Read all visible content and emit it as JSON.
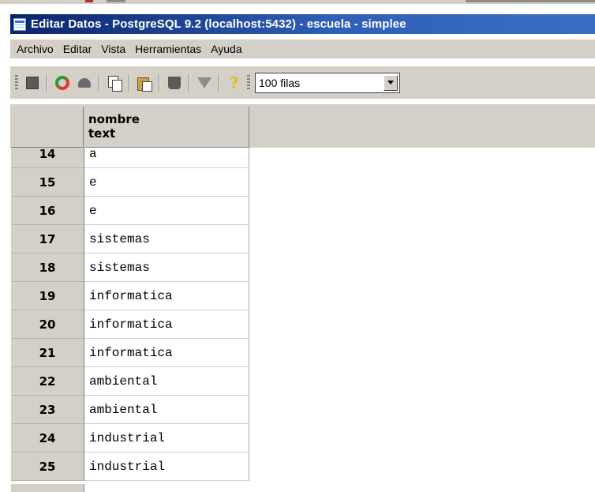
{
  "window": {
    "title": "Editar Datos - PostgreSQL 9.2 (localhost:5432) - escuela - simplee"
  },
  "menu": [
    "Archivo",
    "Editar",
    "Vista",
    "Herramientas",
    "Ayuda"
  ],
  "toolbar": {
    "buttons": [
      "save-icon",
      "refresh-icon",
      "undo-icon",
      "copy-icon",
      "paste-icon",
      "delete-icon",
      "filter-icon",
      "help-icon"
    ],
    "row_limit": "100 filas"
  },
  "grid": {
    "column": {
      "name": "nombre",
      "type": "text"
    },
    "rows": [
      {
        "num": "14",
        "value": "a"
      },
      {
        "num": "15",
        "value": "e"
      },
      {
        "num": "16",
        "value": "e"
      },
      {
        "num": "17",
        "value": "sistemas"
      },
      {
        "num": "18",
        "value": "sistemas"
      },
      {
        "num": "19",
        "value": "informatica"
      },
      {
        "num": "20",
        "value": "informatica"
      },
      {
        "num": "21",
        "value": "informatica"
      },
      {
        "num": "22",
        "value": "ambiental"
      },
      {
        "num": "23",
        "value": "ambiental"
      },
      {
        "num": "24",
        "value": "industrial"
      },
      {
        "num": "25",
        "value": "industrial"
      }
    ]
  },
  "colors": {
    "title_bar": "#0a246a",
    "chrome": "#d4d0c8"
  }
}
